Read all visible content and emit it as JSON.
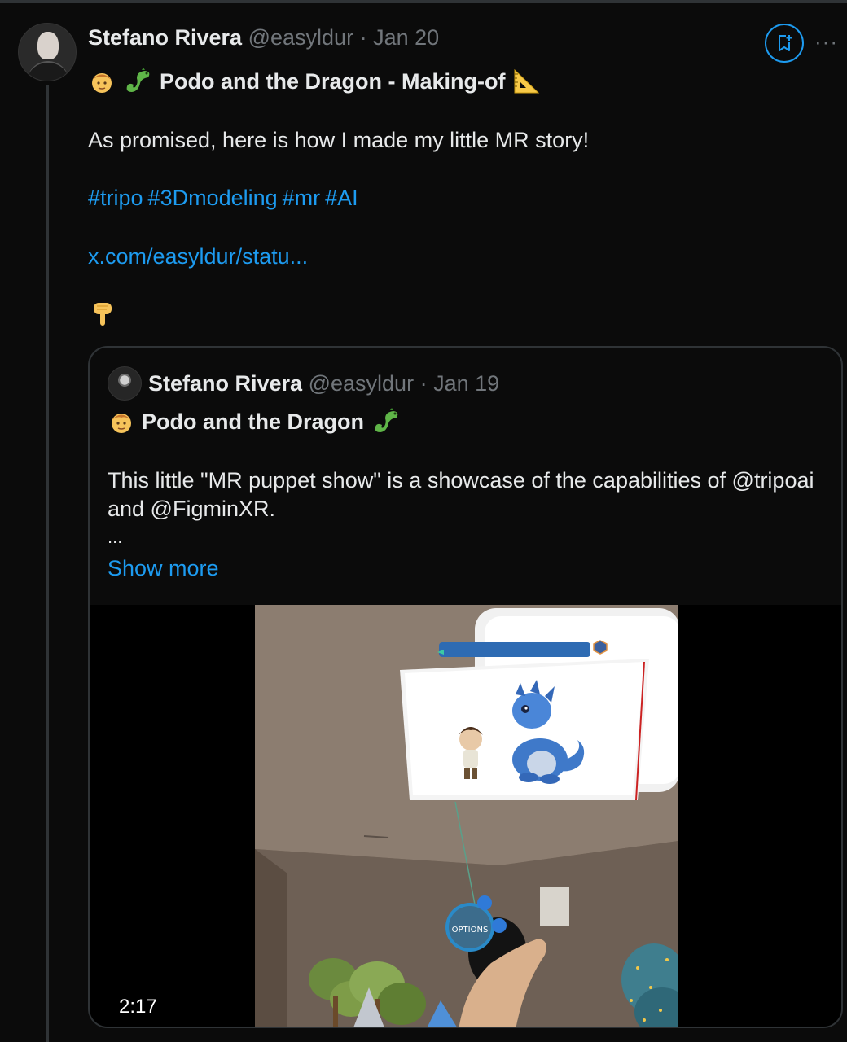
{
  "post": {
    "author_name": "Stefano Rivera",
    "handle": "@easyldur",
    "separator": "·",
    "date": "Jan 20",
    "title": "Podo and the Dragon - Making-of",
    "body": "As promised, here is how I made my little MR story!",
    "hashtags": [
      "#tripo",
      "#3Dmodeling",
      "#mr",
      "#AI"
    ],
    "link": "x.com/easyldur/statu...",
    "more_label": "···"
  },
  "quote": {
    "author_name": "Stefano Rivera",
    "handle": "@easyldur",
    "separator": "·",
    "date": "Jan 19",
    "title": "Podo and the Dragon",
    "body": "This little \"MR puppet show\" is a showcase of the capabilities of @tripoai and @FigminXR.",
    "ellipsis": "...",
    "show_more": "Show more",
    "video": {
      "duration": "2:17",
      "options_label": "OPTIONS"
    }
  },
  "colors": {
    "background": "#0b0b0b",
    "text": "#e7e9ea",
    "muted": "#71767b",
    "accent": "#1d9bf0",
    "border": "#2f3336"
  },
  "icons": [
    "boy-emoji-icon",
    "dragon-emoji-icon",
    "triangular-ruler-emoji-icon",
    "pointing-down-emoji-icon",
    "bookmark-icon",
    "more-icon"
  ]
}
